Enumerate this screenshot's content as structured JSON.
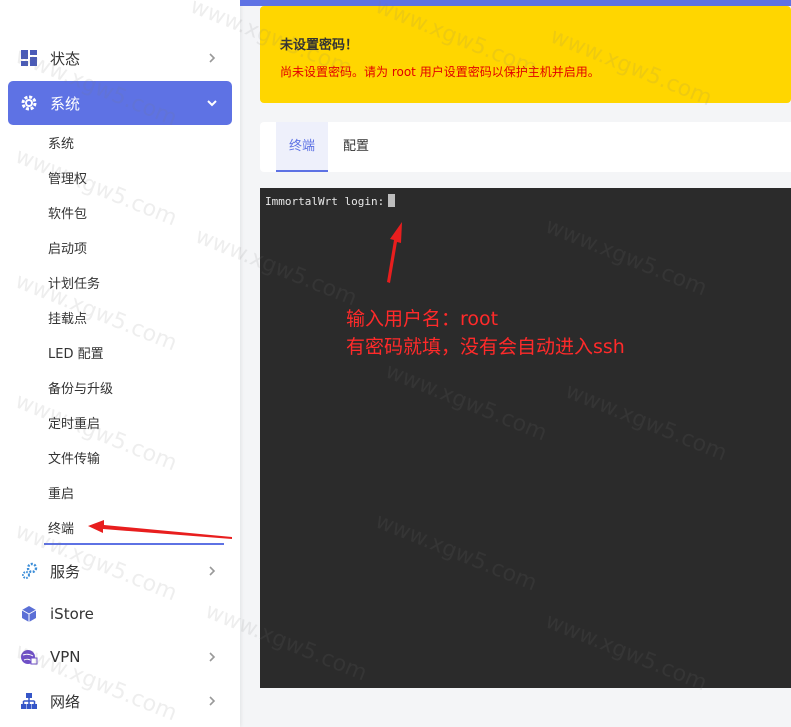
{
  "sidebar": {
    "status": {
      "label": "状态"
    },
    "system": {
      "label": "系统"
    },
    "sub_items": [
      "系统",
      "管理权",
      "软件包",
      "启动项",
      "计划任务",
      "挂载点",
      "LED 配置",
      "备份与升级",
      "定时重启",
      "文件传输",
      "重启",
      "终端"
    ],
    "services": {
      "label": "服务"
    },
    "istore": {
      "label": "iStore"
    },
    "vpn": {
      "label": "VPN"
    },
    "network": {
      "label": "网络"
    }
  },
  "alert": {
    "title": "未设置密码！",
    "message": "尚未设置密码。请为 root 用户设置密码以保护主机并启用。"
  },
  "tabs": [
    {
      "label": "终端"
    },
    {
      "label": "配置"
    }
  ],
  "terminal": {
    "prompt": "ImmortalWrt login:"
  },
  "annotation": {
    "line1": "输入用户名：root",
    "line2": "有密码就填，没有会自动进入ssh"
  },
  "watermark": "www.xgw5.com",
  "colors": {
    "accent": "#5e72e4",
    "alert_bg": "#ffd600",
    "alert_text": "#e20000",
    "terminal_bg": "#2b2b2b",
    "annotation": "#ff2a2a"
  }
}
